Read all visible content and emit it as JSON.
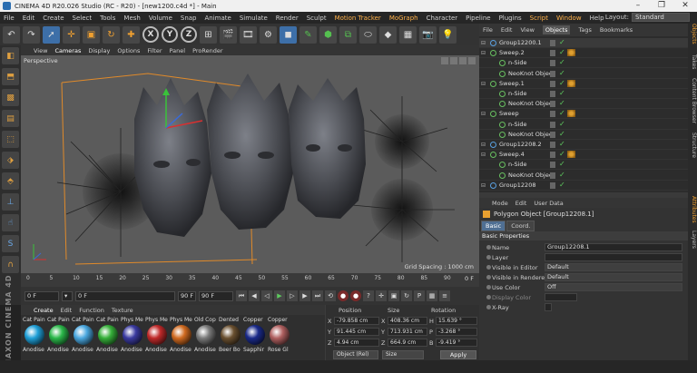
{
  "window": {
    "title": "CINEMA 4D R20.026 Studio (RC - R20) - [new1200.c4d *] - Main"
  },
  "menu": {
    "items": [
      "File",
      "Edit",
      "Create",
      "Select",
      "Tools",
      "Mesh",
      "Volume",
      "Snap",
      "Animate",
      "Simulate",
      "Render",
      "Sculpt",
      "Motion Tracker",
      "MoGraph",
      "Character",
      "Pipeline",
      "Plugins",
      "Script",
      "Window",
      "Help"
    ],
    "layout_label": "Layout:",
    "layout_value": "Standard"
  },
  "viewport": {
    "menu": [
      "View",
      "Cameras",
      "Display",
      "Options",
      "Filter",
      "Panel",
      "ProRender"
    ],
    "label": "Perspective",
    "grid_spacing": "Grid Spacing : 1000 cm"
  },
  "timeline": {
    "ticks": [
      "0",
      "5",
      "10",
      "15",
      "20",
      "25",
      "30",
      "35",
      "40",
      "45",
      "50",
      "55",
      "60",
      "65",
      "70",
      "75",
      "80",
      "85",
      "90"
    ],
    "current_frame": "0 F"
  },
  "transport": {
    "start": "0 F",
    "current": "0 F",
    "preview_end": "90 F",
    "end": "90 F"
  },
  "materials": {
    "menu": [
      "Create",
      "Edit",
      "Function",
      "Texture"
    ],
    "items": [
      {
        "name": "Cat Pain",
        "name2": "Anodise",
        "color": "#1fa0d8"
      },
      {
        "name": "Cat Pain",
        "name2": "Anodise",
        "color": "#2bb84a"
      },
      {
        "name": "Cat Pain",
        "name2": "Anodise",
        "color": "#4aa8e0"
      },
      {
        "name": "Cat Pain",
        "name2": "Anodise",
        "color": "#36b03a"
      },
      {
        "name": "Phys Me",
        "name2": "Anodise",
        "color": "#3a3aa0"
      },
      {
        "name": "Phys Me",
        "name2": "Anodise",
        "color": "#c02a2a"
      },
      {
        "name": "Phys Me",
        "name2": "Anodise",
        "color": "#d06a20"
      },
      {
        "name": "Old Cop",
        "name2": "Anodise",
        "color": "#7a7a7a"
      },
      {
        "name": "Dented",
        "name2": "Beer Bo",
        "color": "#6a5030"
      },
      {
        "name": "Copper",
        "name2": "Sapphir",
        "color": "#1a2a8a"
      },
      {
        "name": "Copper",
        "name2": "Rose Gl",
        "color": "#b06060"
      }
    ]
  },
  "coordinates": {
    "headers": [
      "Position",
      "Size",
      "Rotation"
    ],
    "rows": [
      {
        "axis": "X",
        "pos": "-79.858 cm",
        "size": "408.36 cm",
        "rot_axis": "H",
        "rot": "15.639 °"
      },
      {
        "axis": "Y",
        "pos": "91.445 cm",
        "size": "713.931 cm",
        "rot_axis": "P",
        "rot": "-3.268 °"
      },
      {
        "axis": "Z",
        "pos": "4.94 cm",
        "size": "664.9 cm",
        "rot_axis": "B",
        "rot": "-9.419 °"
      }
    ],
    "mode": "Object (Rel)",
    "size_mode": "Size",
    "apply": "Apply"
  },
  "object_manager": {
    "menu": [
      "File",
      "Edit",
      "View",
      "Objects",
      "Tags",
      "Bookmarks"
    ],
    "rows": [
      {
        "name": "Group12200.1",
        "indent": 0,
        "icon": "null-icon",
        "selected": true,
        "tag": "none"
      },
      {
        "name": "Sweep.2",
        "indent": 0,
        "icon": "sweep-icon",
        "selected": false,
        "tag": "material"
      },
      {
        "name": "n-Side",
        "indent": 1,
        "icon": "nside-icon",
        "selected": false,
        "tag": "none"
      },
      {
        "name": "NeoKnot Object",
        "indent": 1,
        "icon": "knot-icon",
        "selected": false,
        "tag": "none"
      },
      {
        "name": "Sweep.1",
        "indent": 0,
        "icon": "sweep-icon",
        "selected": false,
        "tag": "material"
      },
      {
        "name": "n-Side",
        "indent": 1,
        "icon": "nside-icon",
        "selected": false,
        "tag": "none"
      },
      {
        "name": "NeoKnot Object",
        "indent": 1,
        "icon": "knot-icon",
        "selected": false,
        "tag": "none"
      },
      {
        "name": "Sweep",
        "indent": 0,
        "icon": "sweep-icon",
        "selected": false,
        "tag": "material"
      },
      {
        "name": "n-Side",
        "indent": 1,
        "icon": "nside-icon",
        "selected": false,
        "tag": "none"
      },
      {
        "name": "NeoKnot Object",
        "indent": 1,
        "icon": "knot-icon",
        "selected": false,
        "tag": "none"
      },
      {
        "name": "Group12208.2",
        "indent": 0,
        "icon": "null-icon",
        "selected": false,
        "tag": "none"
      },
      {
        "name": "Sweep.4",
        "indent": 0,
        "icon": "sweep-icon",
        "selected": false,
        "tag": "material"
      },
      {
        "name": "n-Side",
        "indent": 1,
        "icon": "nside-icon",
        "selected": false,
        "tag": "none"
      },
      {
        "name": "NeoKnot Object",
        "indent": 1,
        "icon": "knot-icon",
        "selected": false,
        "tag": "none"
      },
      {
        "name": "Group12208",
        "indent": 0,
        "icon": "null-icon",
        "selected": false,
        "tag": "none"
      }
    ]
  },
  "attributes": {
    "menu": [
      "Mode",
      "Edit",
      "User Data"
    ],
    "title": "Polygon Object [Group12208.1]",
    "tabs": [
      "Basic",
      "Coord."
    ],
    "section": "Basic Properties",
    "fields": [
      {
        "label": "Name",
        "value": "Group12208.1",
        "type": "text"
      },
      {
        "label": "Layer",
        "value": "",
        "type": "text"
      },
      {
        "label": "Visible in Editor",
        "value": "Default",
        "type": "drop"
      },
      {
        "label": "Visible in Renderer",
        "value": "Default",
        "type": "drop"
      },
      {
        "label": "Use Color",
        "value": "Off",
        "type": "drop"
      },
      {
        "label": "Display Color",
        "value": "",
        "type": "color"
      },
      {
        "label": "X-Ray",
        "value": "",
        "type": "check"
      }
    ]
  },
  "right_tabs": [
    "Objects",
    "Takes",
    "Content Browser",
    "Structure",
    "Attributes",
    "Layers"
  ]
}
